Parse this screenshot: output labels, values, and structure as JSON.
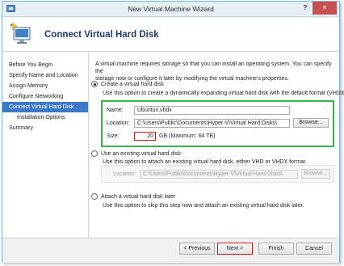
{
  "window": {
    "title": "New Virtual Machine Wizard",
    "help_label": "?",
    "close_label": "✕"
  },
  "header": {
    "title": "Connect Virtual Hard Disk"
  },
  "nav": {
    "items": [
      {
        "label": "Before You Begin"
      },
      {
        "label": "Specify Name and Location"
      },
      {
        "label": "Assign Memory"
      },
      {
        "label": "Configure Networking"
      },
      {
        "label": "Connect Virtual Hard Disk"
      },
      {
        "label": "Installation Options"
      },
      {
        "label": "Summary"
      }
    ]
  },
  "content": {
    "intro_line1": "A virtual machine requires storage so that you can install an operating system. You can specify the",
    "intro_line2": "storage now or configure it later by modifying the virtual machine's properties.",
    "option_create": {
      "label": "Create a virtual hard disk",
      "description": "Use this option to create a dynamically expanding virtual hard disk with the default format (VHDX).",
      "name_label": "Name:",
      "name_value": "Ubuntux.vhdx",
      "location_label": "Location:",
      "location_value": "C:\\Users\\Public\\Documents\\Hyper-V\\Virtual Hard Disks\\",
      "browse_label": "Browse...",
      "size_label": "Size:",
      "size_value": "20",
      "size_unit": "GB (Maximum: 64 TB)"
    },
    "option_existing": {
      "label": "Use an existing virtual hard disk",
      "description": "Use this option to attach an existing virtual hard disk, either VHD or VHDX format.",
      "location_label": "Location:",
      "location_value": "C:\\Users\\Public\\Documents\\Hyper-V\\Virtual Hard Disks\\",
      "browse_label": "Browse..."
    },
    "option_later": {
      "label": "Attach a virtual hard disk later",
      "description": "Use this option to skip this step now and attach an existing virtual hard disk later."
    }
  },
  "footer": {
    "previous_label": "< Previous",
    "next_label": "Next >",
    "finish_label": "Finish",
    "cancel_label": "Cancel"
  },
  "colors": {
    "nav_active": "#3b7ac9",
    "highlight_green": "#37b34a",
    "highlight_red": "#d11b1b",
    "header_title": "#1d3c6e"
  }
}
